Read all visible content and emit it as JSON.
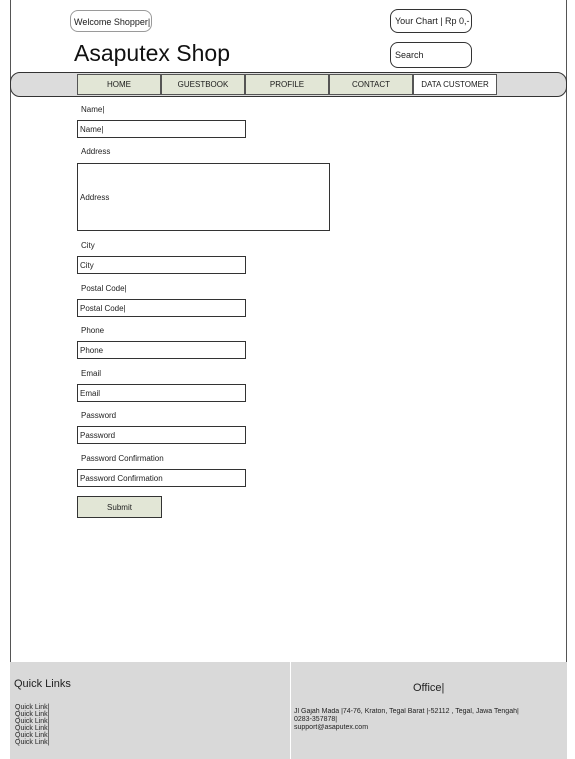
{
  "header": {
    "welcome_text": "Welcome Shopper|",
    "cart_text": "Your Chart | Rp 0,-",
    "shop_title": "Asaputex Shop",
    "search_placeholder": "Search"
  },
  "nav": {
    "items": [
      {
        "label": "HOME"
      },
      {
        "label": "GUESTBOOK"
      },
      {
        "label": "PROFILE"
      },
      {
        "label": "CONTACT"
      },
      {
        "label": "DATA CUSTOMER",
        "active": true
      }
    ]
  },
  "form": {
    "name_label": "Name|",
    "name_placeholder": "Name|",
    "address_label": "Address",
    "address_placeholder": "Address",
    "city_label": "City",
    "city_placeholder": "City",
    "postal_label": "Postal Code|",
    "postal_placeholder": "Postal Code|",
    "phone_label": "Phone",
    "phone_placeholder": "Phone",
    "email_label": "Email",
    "email_placeholder": "Email",
    "password_label": "Password",
    "password_placeholder": "Password",
    "confirm_label": "Password Confirmation",
    "confirm_placeholder": "Password Confirmation",
    "submit_label": "Submit"
  },
  "footer": {
    "quick_links_title": "Quick Links",
    "quick_links": [
      "Quick Link|",
      "Quick Link|",
      "Quick Link|",
      "Quick Link|",
      "Quick Link|",
      "Quick Link|"
    ],
    "office_title": "Office|",
    "office_address": "Jl Gajah Mada |74-76, Kraton, Tegal Barat |-52112 , Tegal, Jawa Tengah|",
    "office_phone": "0283-357878|",
    "office_email": "support@asaputex.com"
  }
}
